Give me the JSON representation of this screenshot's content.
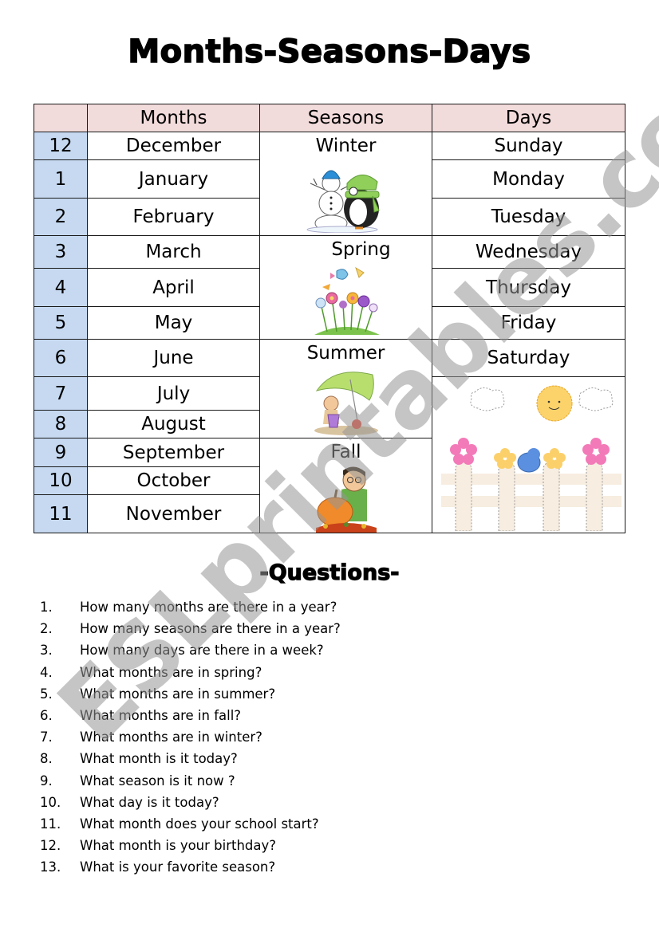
{
  "title": "Months-Seasons-Days",
  "table": {
    "headers": {
      "number": "",
      "months": "Months",
      "seasons": "Seasons",
      "days": "Days"
    },
    "rows": [
      {
        "number": "12",
        "month": "December"
      },
      {
        "number": "1",
        "month": "January"
      },
      {
        "number": "2",
        "month": "February"
      },
      {
        "number": "3",
        "month": "March"
      },
      {
        "number": "4",
        "month": "April"
      },
      {
        "number": "5",
        "month": "May"
      },
      {
        "number": "6",
        "month": "June"
      },
      {
        "number": "7",
        "month": "July"
      },
      {
        "number": "8",
        "month": "August"
      },
      {
        "number": "9",
        "month": "September"
      },
      {
        "number": "10",
        "month": "October"
      },
      {
        "number": "11",
        "month": "November"
      }
    ],
    "seasons": [
      {
        "label": "Winter",
        "illustration": "snowman-and-penguin"
      },
      {
        "label": "Spring",
        "illustration": "flowers-and-butterflies"
      },
      {
        "label": "Summer",
        "illustration": "child-under-umbrella-on-beach"
      },
      {
        "label": "Fall",
        "illustration": "boy-with-pumpkin"
      }
    ],
    "days": [
      "Sunday",
      "Monday",
      "Tuesday",
      "Wednesday",
      "Thursday",
      "Friday",
      "Saturday"
    ],
    "days_illustration": "sun-clouds-flowers-fence",
    "colors": {
      "header_bg": "#f2dbdb",
      "number_bg": "#c6d9f1",
      "border": "#1a1a1a"
    }
  },
  "questions_title": "-Questions-",
  "questions": [
    {
      "n": "1.",
      "text": "How many months are there in a year?"
    },
    {
      "n": "2.",
      "text": "How many seasons are there in a year?"
    },
    {
      "n": "3.",
      "text": "How many days are there in a week?"
    },
    {
      "n": "4.",
      "text": "What months are in spring?"
    },
    {
      "n": "5.",
      "text": "What months are in summer?"
    },
    {
      "n": "6.",
      "text": "What months are in fall?"
    },
    {
      "n": "7.",
      "text": "What months are in winter?"
    },
    {
      "n": "8.",
      "text": "What month is it today?"
    },
    {
      "n": "9.",
      "text": "What season is it now ?"
    },
    {
      "n": "10.",
      "text": "What day is it today?"
    },
    {
      "n": "11.",
      "text": "What month does your school start?"
    },
    {
      "n": "12.",
      "text": "What month is your birthday?"
    },
    {
      "n": "13.",
      "text": "What is your favorite season?"
    }
  ],
  "watermark": "ESLprintables.com"
}
